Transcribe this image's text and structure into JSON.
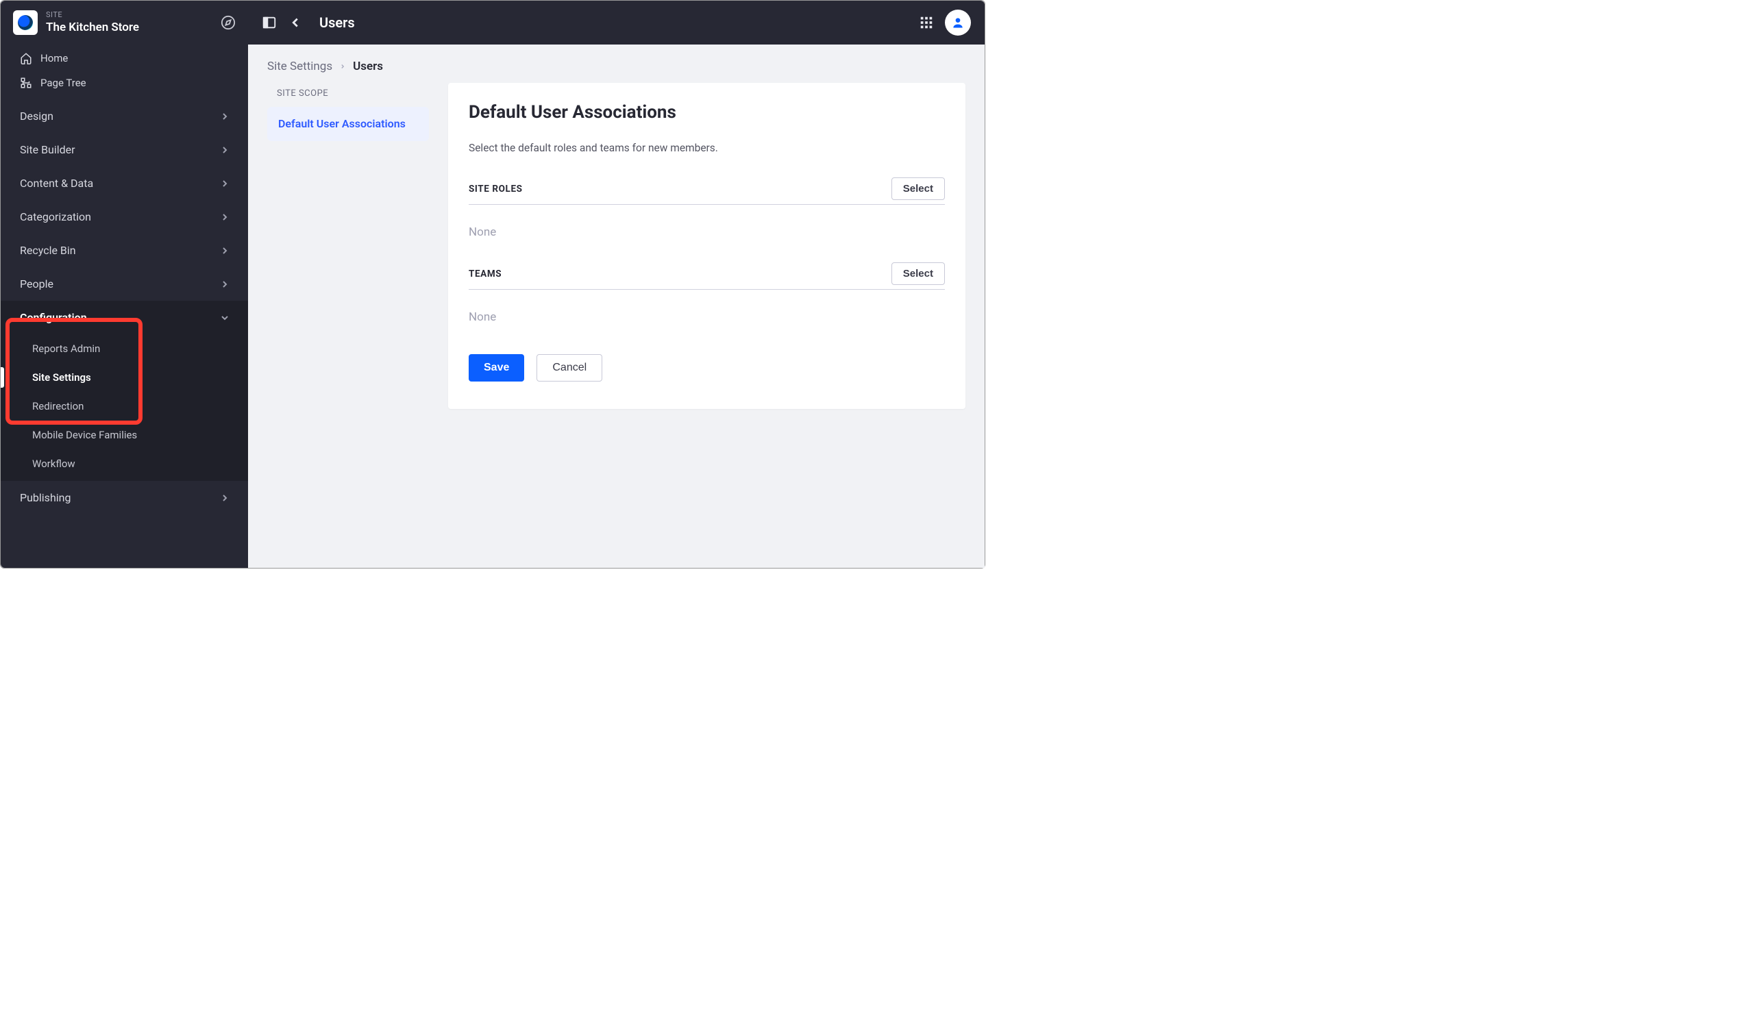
{
  "sidebar": {
    "eyebrow": "SITE",
    "title": "The Kitchen Store",
    "topnav": [
      {
        "label": "Home",
        "icon": "home"
      },
      {
        "label": "Page Tree",
        "icon": "pagetree"
      }
    ],
    "sections": [
      {
        "label": "Design",
        "expanded": false
      },
      {
        "label": "Site Builder",
        "expanded": false
      },
      {
        "label": "Content & Data",
        "expanded": false
      },
      {
        "label": "Categorization",
        "expanded": false
      },
      {
        "label": "Recycle Bin",
        "expanded": false
      },
      {
        "label": "People",
        "expanded": false
      },
      {
        "label": "Configuration",
        "expanded": true,
        "items": [
          {
            "label": "Reports Admin",
            "active": false
          },
          {
            "label": "Site Settings",
            "active": true
          },
          {
            "label": "Redirection",
            "active": false
          },
          {
            "label": "Mobile Device Families",
            "active": false
          },
          {
            "label": "Workflow",
            "active": false
          }
        ]
      },
      {
        "label": "Publishing",
        "expanded": false
      }
    ]
  },
  "topbar": {
    "title": "Users"
  },
  "breadcrumb": {
    "parent": "Site Settings",
    "current": "Users"
  },
  "leftnav": {
    "heading": "SITE SCOPE",
    "items": [
      {
        "label": "Default User Associations",
        "active": true
      }
    ]
  },
  "panel": {
    "title": "Default User Associations",
    "desc": "Select the default roles and teams for new members.",
    "groups": [
      {
        "heading": "SITE ROLES",
        "value": "None",
        "select_label": "Select"
      },
      {
        "heading": "TEAMS",
        "value": "None",
        "select_label": "Select"
      }
    ],
    "save_label": "Save",
    "cancel_label": "Cancel"
  }
}
